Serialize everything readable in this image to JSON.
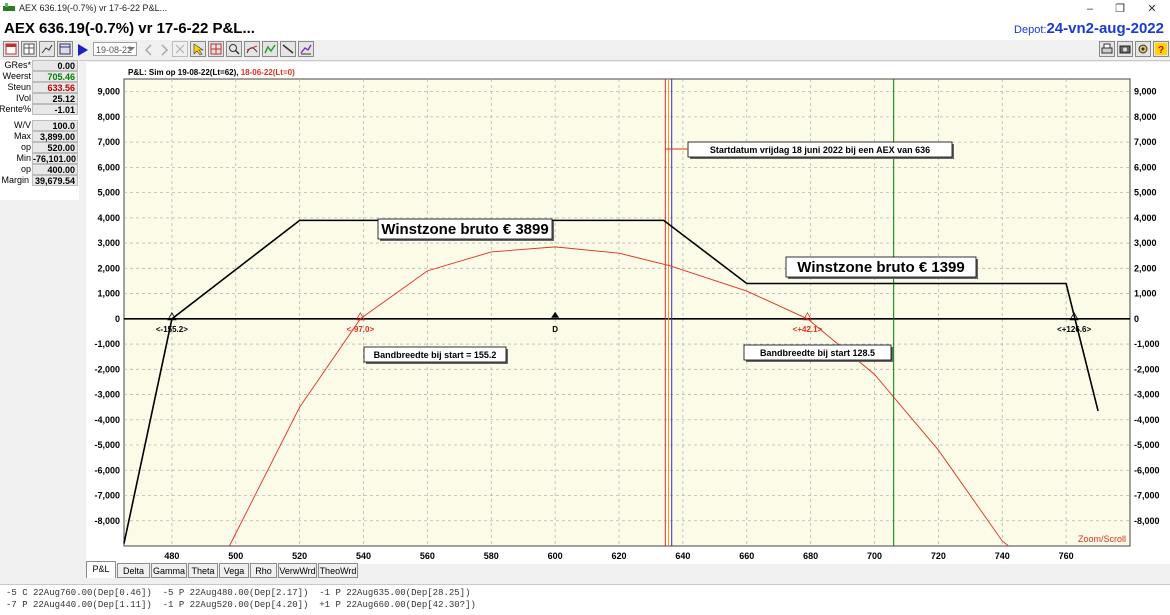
{
  "window": {
    "title": "AEX 636.19(-0.7%)  vr 17-6-22  P&L...",
    "controls": [
      "–",
      "❐",
      "✕"
    ]
  },
  "header": {
    "main": "AEX 636.19(-0.7%)  vr 17-6-22  P&L...",
    "depot_label": "Depot:",
    "depot_value": "24-vn2-aug-2022"
  },
  "toolbar": {
    "date_value": "19-08-22",
    "icons": [
      "calendar-icon",
      "grid-icon",
      "chart-icon",
      "table-icon",
      "arrow-right-icon",
      "dropdown-icon",
      "nav-left-icon",
      "cross-icon",
      "pointer-icon",
      "grid-select-icon",
      "zoom-icon",
      "curve-icon",
      "graph-icon",
      "line-icon",
      "chart-line-icon"
    ],
    "right_icons": [
      "print-icon",
      "camera-icon",
      "settings-icon",
      "help-icon"
    ]
  },
  "left_panel": {
    "rows": [
      {
        "label": "GRes*",
        "value": "0.00",
        "color": "normal"
      },
      {
        "label": "Weerst",
        "value": "705.46",
        "color": "green"
      },
      {
        "label": "Steun",
        "value": "633.56",
        "color": "red"
      },
      {
        "label": "IVol",
        "value": "25.12",
        "color": "normal"
      },
      {
        "label": "Rente%",
        "value": "-1.01",
        "color": "normal"
      },
      {
        "label": "W/V",
        "value": "100.0",
        "color": "normal"
      },
      {
        "label": "Max",
        "value": "3,899.00",
        "color": "normal"
      },
      {
        "label": "op",
        "value": "520.00",
        "color": "normal"
      },
      {
        "label": "Min",
        "value": "-76,101.00",
        "color": "normal"
      },
      {
        "label": "op",
        "value": "400.00",
        "color": "normal"
      },
      {
        "label": "Margin",
        "value": "39,679.54",
        "color": "normal"
      }
    ]
  },
  "chart_data": {
    "type": "line",
    "header_black": "P&L:  Sim op 19-08-22(Lt=62),",
    "header_red": "18-06-22(Lt=0)",
    "x_ticks": [
      "480",
      "500",
      "520",
      "540",
      "560",
      "580",
      "600",
      "620",
      "640",
      "660",
      "680",
      "700",
      "720",
      "740",
      "760"
    ],
    "y_ticks": [
      "9,000",
      "8,000",
      "7,000",
      "6,000",
      "5,000",
      "4,000",
      "3,000",
      "2,000",
      "1,000",
      "0",
      "-1,000",
      "-2,000",
      "-3,000",
      "-4,000",
      "-5,000",
      "-6,000",
      "-7,000",
      "-8,000"
    ],
    "xlim": [
      465,
      780
    ],
    "ylim": [
      -9000,
      9500
    ],
    "series": [
      {
        "color": "#000000",
        "x": [
          465,
          480,
          520,
          634,
          660,
          760,
          770
        ],
        "y": [
          -8900,
          0,
          3899,
          3899,
          1399,
          1399,
          -3650
        ]
      },
      {
        "color": "#e03020",
        "x": [
          498,
          520,
          539,
          560,
          580,
          600,
          620,
          636,
          660,
          679,
          700,
          720,
          740,
          742
        ],
        "y": [
          -9000,
          -3500,
          0,
          1900,
          2650,
          2850,
          2600,
          2100,
          1100,
          0,
          -2200,
          -5200,
          -8800,
          -9000
        ]
      }
    ],
    "markers": [
      {
        "x": 480,
        "label": "<-155.2>",
        "color": "#000000"
      },
      {
        "x": 539,
        "label": "<-97.0>",
        "color": "#e03020"
      },
      {
        "x": 600,
        "label": "D",
        "color": "#000000"
      },
      {
        "x": 679,
        "label": "<+42.1>",
        "color": "#e03020"
      },
      {
        "x": 762.5,
        "label": "<+126.6>",
        "color": "#000000"
      }
    ],
    "vlines": [
      {
        "x": 634.5,
        "color": "#e03020"
      },
      {
        "x": 635.5,
        "color": "#ff9030"
      },
      {
        "x": 636.5,
        "color": "#3030c0"
      },
      {
        "x": 706,
        "color": "#008000"
      }
    ],
    "annotations": [
      {
        "text": "Startdatum vrijdag 18 juni 2022 bij een AEX van 636",
        "size": "small"
      },
      {
        "text": "Winstzone bruto € 3899",
        "size": "big"
      },
      {
        "text": "Winstzone bruto € 1399",
        "size": "big"
      },
      {
        "text": "Bandbreedte bij start = 155.2",
        "size": "small"
      },
      {
        "text": "Bandbreedte bij start 128.5",
        "size": "small"
      }
    ],
    "zoom_label": "Zoom/Scroll",
    "background": "#fbfbe8"
  },
  "tabs": [
    "P&L",
    "Delta",
    "Gamma",
    "Theta",
    "Vega",
    "Rho",
    "VerwWrd",
    "TheoWrd"
  ],
  "bottom": {
    "line1": "-5 C 22Aug760.00(Dep[0.46])  -5 P 22Aug480.00(Dep[2.17])  -1 P 22Aug635.00(Dep[28.25])",
    "line2": "-7 P 22Aug440.00(Dep[1.11])  -1 P 22Aug520.00(Dep[4.20])  +1 P 22Aug660.00(Dep[42.30?])"
  }
}
